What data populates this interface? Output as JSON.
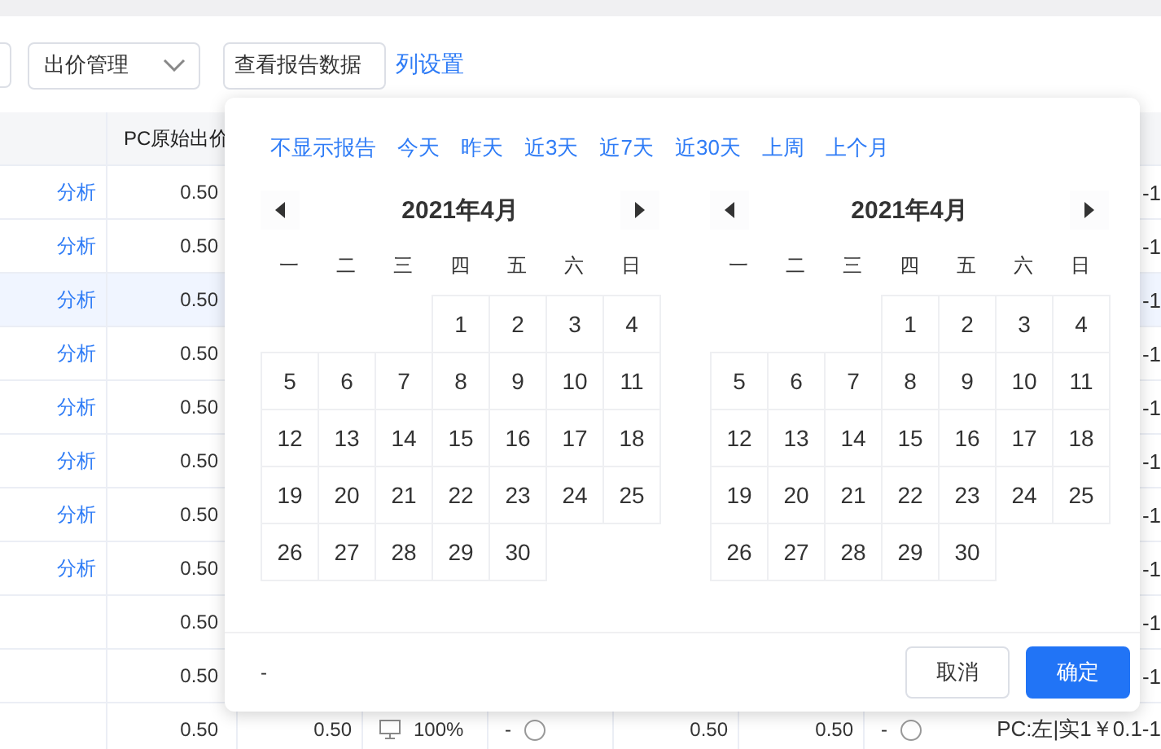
{
  "toolbar": {
    "select": {
      "value": "出价管理"
    },
    "report_field": {
      "value": "查看报告数据"
    },
    "column_settings_link": "列设置"
  },
  "table": {
    "header": {
      "pc_bid": "PC原始出价"
    },
    "rows": [
      {
        "analysis": "分析",
        "pc_bid": "0.50",
        "tail": "-1",
        "selected": false
      },
      {
        "analysis": "分析",
        "pc_bid": "0.50",
        "tail": "-1",
        "selected": false
      },
      {
        "analysis": "分析",
        "pc_bid": "0.50",
        "tail": "-1",
        "selected": true
      },
      {
        "analysis": "分析",
        "pc_bid": "0.50",
        "tail": "-1",
        "selected": false
      },
      {
        "analysis": "分析",
        "pc_bid": "0.50",
        "tail": "-1",
        "selected": false
      },
      {
        "analysis": "分析",
        "pc_bid": "0.50",
        "tail": "-1",
        "selected": false
      },
      {
        "analysis": "分析",
        "pc_bid": "0.50",
        "tail": "-1",
        "selected": false
      },
      {
        "analysis": "分析",
        "pc_bid": "0.50",
        "tail": "-1",
        "selected": false
      },
      {
        "pc_bid": "0.50",
        "tail": "-1",
        "selected": false
      },
      {
        "pc_bid": "0.50",
        "tail": "-1",
        "selected": false
      },
      {
        "pc_bid": "0.50",
        "selected": false,
        "cells": [
          "0.50",
          "100%",
          "-",
          "0.50",
          "0.50",
          "-"
        ],
        "tail": "PC:左|实1￥0.1-1"
      }
    ]
  },
  "date_popup": {
    "shortcuts": [
      "不显示报告",
      "今天",
      "昨天",
      "近3天",
      "近7天",
      "近30天",
      "上周",
      "上个月"
    ],
    "calendars": [
      {
        "title": "2021年4月",
        "weekdays": [
          "一",
          "二",
          "三",
          "四",
          "五",
          "六",
          "日"
        ],
        "weeks": [
          [
            "1",
            "2",
            "3",
            "4"
          ],
          [
            "5",
            "6",
            "7",
            "8",
            "9",
            "10",
            "11"
          ],
          [
            "12",
            "13",
            "14",
            "15",
            "16",
            "17",
            "18"
          ],
          [
            "19",
            "20",
            "21",
            "22",
            "23",
            "24",
            "25"
          ],
          [
            "26",
            "27",
            "28",
            "29",
            "30"
          ]
        ]
      },
      {
        "title": "2021年4月",
        "weekdays": [
          "一",
          "二",
          "三",
          "四",
          "五",
          "六",
          "日"
        ],
        "weeks": [
          [
            "1",
            "2",
            "3",
            "4"
          ],
          [
            "5",
            "6",
            "7",
            "8",
            "9",
            "10",
            "11"
          ],
          [
            "12",
            "13",
            "14",
            "15",
            "16",
            "17",
            "18"
          ],
          [
            "19",
            "20",
            "21",
            "22",
            "23",
            "24",
            "25"
          ],
          [
            "26",
            "27",
            "28",
            "29",
            "30"
          ]
        ]
      }
    ],
    "range_text": "-",
    "buttons": [
      {
        "label": "取消",
        "kind": "secondary"
      },
      {
        "label": "确定",
        "kind": "primary"
      }
    ]
  }
}
